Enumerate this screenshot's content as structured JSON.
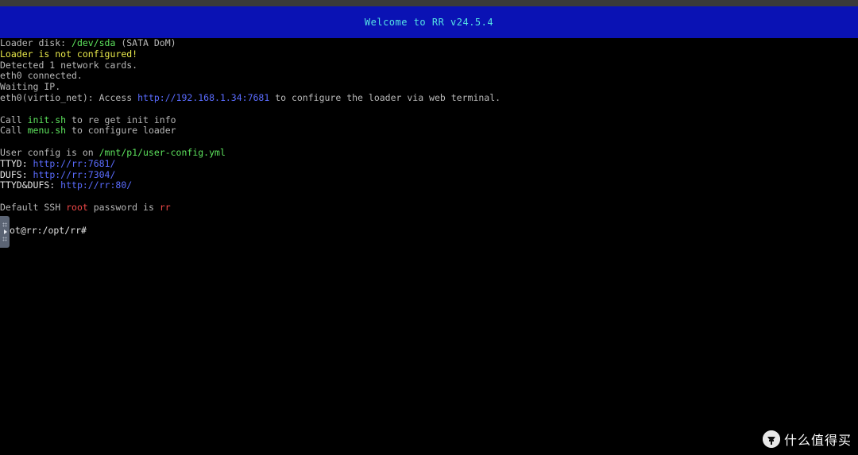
{
  "banner": {
    "title": "Welcome to RR v24.5.4"
  },
  "console": {
    "l1": {
      "a": "Loader disk: ",
      "b": "/dev/sda",
      "c": " (SATA DoM)"
    },
    "l2": "Loader is not configured!",
    "l3": "Detected 1 network cards.",
    "l4": "eth0 connected.",
    "l5": "Waiting IP.",
    "l6": {
      "a": "eth0(virtio_net): Access ",
      "b": "http://192.168.1.34:7681",
      "c": " to configure the loader via web terminal."
    },
    "l7": {
      "a": "Call ",
      "b": "init.sh",
      "c": " to re get init info"
    },
    "l8": {
      "a": "Call ",
      "b": "menu.sh",
      "c": " to configure loader"
    },
    "l9": {
      "a": "User config is on ",
      "b": "/mnt/p1/user-config.yml"
    },
    "l10": {
      "a": "TTYD: ",
      "b": "http://rr:7681/"
    },
    "l11": {
      "a": "DUFS: ",
      "b": "http://rr:7304/"
    },
    "l12": {
      "a": "TTYD&DUFS: ",
      "b": "http://rr:80/"
    },
    "l13": {
      "a": "Default SSH ",
      "b": "root",
      "c": " password is ",
      "d": "rr"
    },
    "prompt": "ot@rr:/opt/rr#"
  },
  "watermark": {
    "logo_icon": "smzdm-logo-icon",
    "text": "什么值得买"
  },
  "colors": {
    "banner_bg": "#0a12b4",
    "banner_text": "#55e4e4",
    "green": "#5de35d",
    "yellow": "#e8e84a",
    "blue": "#5a6cff",
    "red": "#f04848"
  }
}
